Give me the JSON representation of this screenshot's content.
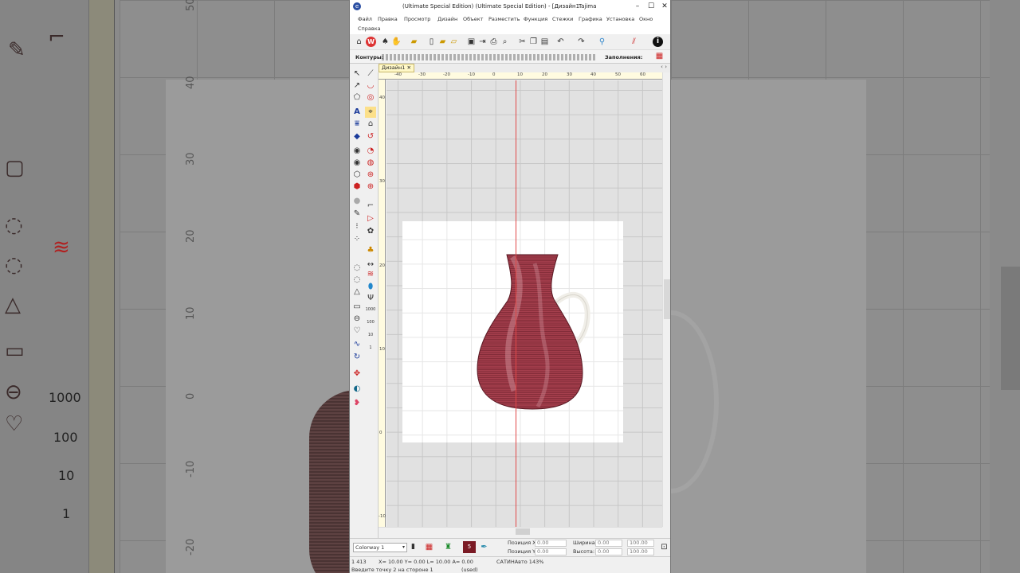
{
  "window": {
    "title": "(Ultimate Special Edition) (Ultimate Special Edition) - [Дизайн1",
    "brand": "Tajima",
    "minimize": "–",
    "maximize": "☐",
    "close": "✕"
  },
  "menu": [
    "Файл",
    "Правка",
    "Просмотр",
    "Дизайн",
    "Объект",
    "Разместить",
    "Функция",
    "Стежки",
    "Графика",
    "Установка",
    "Окно",
    "Справка"
  ],
  "toolbar2": {
    "contours_label": "Контуры:",
    "fills_label": "Заполнения:"
  },
  "tab": {
    "label": "Дизайн1",
    "close": "✕"
  },
  "ruler_top": [
    "-40",
    "-30",
    "-20",
    "-10",
    "0",
    "10",
    "20",
    "30",
    "40",
    "50",
    "60"
  ],
  "ruler_left": [
    "40",
    "30",
    "20",
    "10",
    "0",
    "-10"
  ],
  "bottom": {
    "colorway": "Colorway 1",
    "color_number": "5",
    "pos_x_label": "Позиция X:",
    "pos_y_label": "Позиция Y:",
    "pos_x_value": "0.00",
    "pos_y_value": "0.00",
    "width_label": "Ширина:",
    "height_label": "Высота:",
    "width_value": "0.00",
    "height_value": "0.00",
    "width_pct": "100.00",
    "height_pct": "100.00"
  },
  "status": {
    "count": "1 413",
    "coords": "X=  10.00 Y=   0.00 L=  10.00 A=   0.00",
    "prompt": "Введите точку 2 на стороне 1",
    "used": "(used)",
    "mode": "САТИНАвто 143%"
  },
  "background": {
    "ruler_labels": [
      "50",
      "40",
      "30",
      "20",
      "10",
      "0",
      "-10",
      "-20"
    ],
    "counts": [
      "1000",
      "100",
      "10",
      "1"
    ]
  },
  "colors": {
    "thread": "#9e3a48",
    "guide": "#e04848",
    "hoop": "#ffffff",
    "canvas": "#e1e1e1"
  }
}
